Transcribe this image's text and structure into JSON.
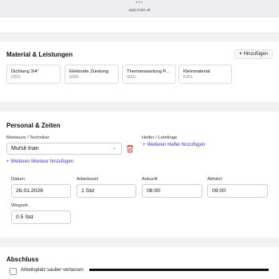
{
  "browser": {
    "dots": "•••",
    "url": "app.inan.at"
  },
  "material": {
    "title": "Material & Leistungen",
    "add_label": "Hinzufügen",
    "items": [
      {
        "name": "Dichtung 3/4\"",
        "code": "D001"
      },
      {
        "name": "Elektrode Zündung",
        "code": "E005"
      },
      {
        "name": "Thermenwartung P...",
        "code": "S001"
      },
      {
        "name": "Kleinmaterial",
        "code": "K001"
      }
    ]
  },
  "personal": {
    "title": "Personal & Zeiten",
    "monteure_label": "Monteure / Techniker",
    "monteur_value": "Mursit Inan",
    "helfer_label": "Helfer / Lehrlinge",
    "add_helfer": "Weiteren Helfer hinzufügen",
    "add_monteur": "Weiteren Monteur hinzufügen",
    "fields": {
      "datum": {
        "label": "Datum",
        "value": "26.01.2026"
      },
      "arbeitszeit": {
        "label": "Arbeitszeit",
        "value": "1 Std"
      },
      "ankunft": {
        "label": "Ankunft",
        "value": "08:00"
      },
      "abfahrt": {
        "label": "Abfahrt",
        "value": "09:00"
      },
      "wegzeit": {
        "label": "Wegzeit",
        "value": "0.5 Std"
      }
    }
  },
  "abschluss": {
    "title": "Abschluss",
    "checkbox_label": "Arbeitsplatz sauber verlassen"
  }
}
